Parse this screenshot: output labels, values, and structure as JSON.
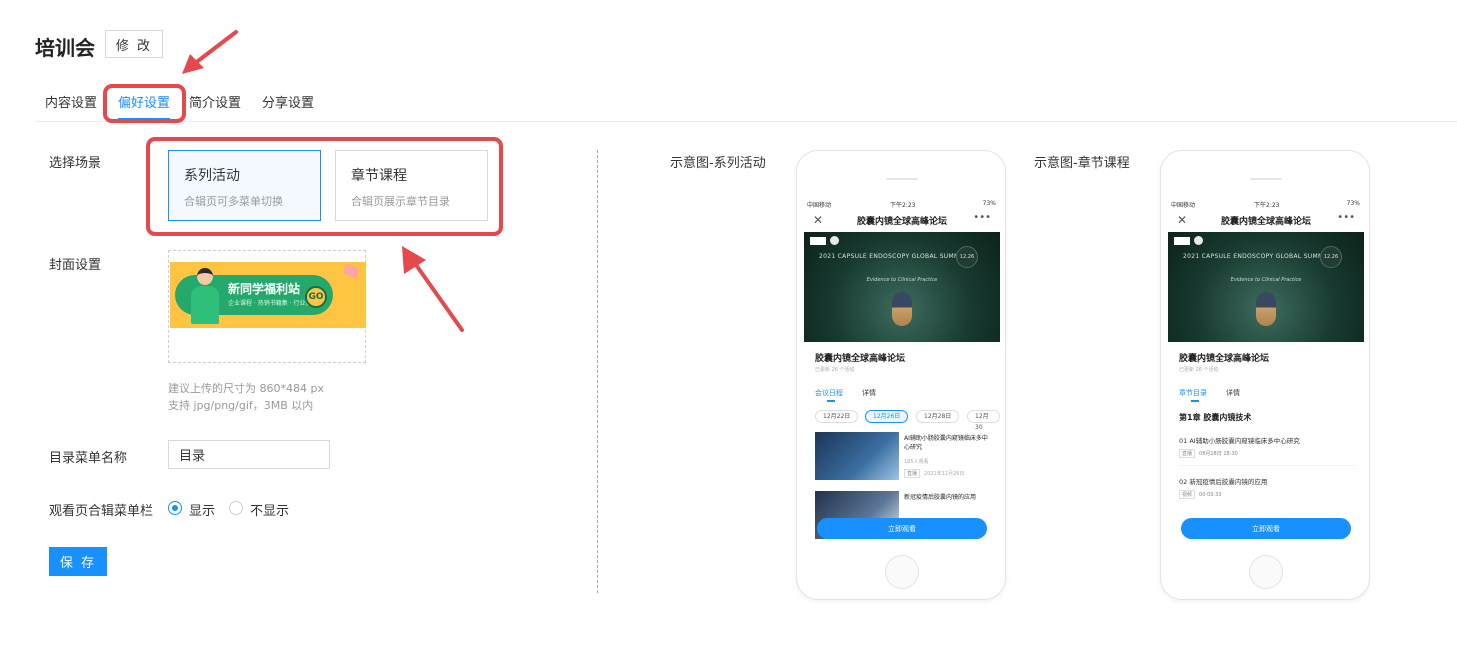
{
  "header": {
    "title": "培训会",
    "edit_label": "修 改"
  },
  "tabs": [
    {
      "label": "内容设置",
      "active": false
    },
    {
      "label": "偏好设置",
      "active": true
    },
    {
      "label": "简介设置",
      "active": false
    },
    {
      "label": "分享设置",
      "active": false
    }
  ],
  "form": {
    "scene_label": "选择场景",
    "scenes": [
      {
        "title": "系列活动",
        "desc": "合辑页可多菜单切换",
        "selected": true
      },
      {
        "title": "章节课程",
        "desc": "合辑页展示章节目录",
        "selected": false
      }
    ],
    "cover_label": "封面设置",
    "cover": {
      "text": "新同学福利站",
      "sub": "企业课程 · 热销书籍集 · 行业资料",
      "badge": "GO"
    },
    "cover_hint_1": "建议上传的尺寸为 860*484 px",
    "cover_hint_2": "支持 jpg/png/gif，3MB 以内",
    "menu_name_label": "目录菜单名称",
    "menu_name_value": "目录",
    "menubar_label": "观看页合辑菜单栏",
    "radio_show": "显示",
    "radio_hide": "不显示",
    "menubar_show": true,
    "save_label": "保 存"
  },
  "preview": {
    "series_label": "示意图-系列活动",
    "chapter_label": "示意图-章节课程",
    "status_left": "中国移动",
    "status_time": "下午2:23",
    "status_right": "73%",
    "nav_title": "胶囊内镜全球高峰论坛",
    "banner_line": "2021  CAPSULE ENDOSCOPY GLOBAL SUMMIT",
    "banner_date": "12.26",
    "banner_tagline": "Evidence to Clinical Practice",
    "event_title": "胶囊内镜全球高峰论坛",
    "event_sub": "已更新 26 个活动",
    "watch_label": "立即观看",
    "series": {
      "tab_agenda": "会议日程",
      "tab_detail": "详情",
      "dates": [
        "12月22日",
        "12月26日",
        "12月28日",
        "12月30"
      ],
      "item1_title": "AI辅助小肠胶囊内窥镜临床多中心研究",
      "item1_views": "165人观看",
      "item1_badge": "直播",
      "item1_date": "2021年12月26日",
      "item2_title": "新冠疫情后胶囊内镜的应用"
    },
    "chapter": {
      "tab_chapters": "章节目录",
      "tab_detail": "详情",
      "chapter_title": "第1章  胶囊内镜技术",
      "lesson1_title": "01  AI辅助小肠胶囊内窥镜临床多中心研究",
      "lesson1_badge": "直播",
      "lesson1_time": "08月18日 18:30",
      "lesson2_title": "02  新冠疫情后胶囊内镜的应用",
      "lesson2_badge": "视频",
      "lesson2_time": "00:09:33"
    }
  },
  "colors": {
    "accent": "#1890ff",
    "highlight": "#e5484d"
  }
}
